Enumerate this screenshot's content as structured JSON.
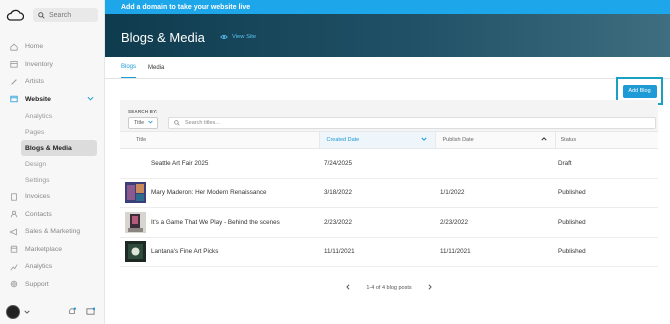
{
  "sidebar": {
    "search_placeholder": "Search",
    "items": [
      {
        "label": "Home"
      },
      {
        "label": "Inventory"
      },
      {
        "label": "Artists"
      },
      {
        "label": "Website"
      },
      {
        "label": "Invoices"
      },
      {
        "label": "Contacts"
      },
      {
        "label": "Sales & Marketing"
      },
      {
        "label": "Marketplace"
      },
      {
        "label": "Analytics"
      },
      {
        "label": "Support"
      }
    ],
    "website_sub": [
      {
        "label": "Analytics"
      },
      {
        "label": "Pages"
      },
      {
        "label": "Blogs & Media"
      },
      {
        "label": "Design"
      },
      {
        "label": "Settings"
      }
    ]
  },
  "banner": {
    "text": "Add a domain to take your website live"
  },
  "hero": {
    "title": "Blogs & Media",
    "view_site": "View Site"
  },
  "tabs": [
    {
      "label": "Blogs"
    },
    {
      "label": "Media"
    }
  ],
  "toolbar": {
    "add_blog": "Add Blog"
  },
  "filter": {
    "search_by": "SEARCH BY:",
    "field": "Title",
    "placeholder": "Search titles..."
  },
  "table": {
    "headers": [
      "Title",
      "Created Date",
      "Publish Date",
      "Status"
    ],
    "rows": [
      {
        "title": "Seattle Art Fair 2025",
        "created": "7/24/2025",
        "published": "",
        "status": "Draft"
      },
      {
        "title": "Mary Maderon: Her Modern Renaissance",
        "created": "3/18/2022",
        "published": "1/1/2022",
        "status": "Published"
      },
      {
        "title": "It's a Game That We Play - Behind the scenes",
        "created": "2/23/2022",
        "published": "2/23/2022",
        "status": "Published"
      },
      {
        "title": "Lantana's Fine Art Picks",
        "created": "11/11/2021",
        "published": "11/11/2021",
        "status": "Published"
      }
    ]
  },
  "pager": {
    "text": "1-4 of 4 blog posts"
  },
  "colors": {
    "accent": "#1e9ad6",
    "banner": "#1ea6ea",
    "highlight_border": "#1aa0c2"
  }
}
